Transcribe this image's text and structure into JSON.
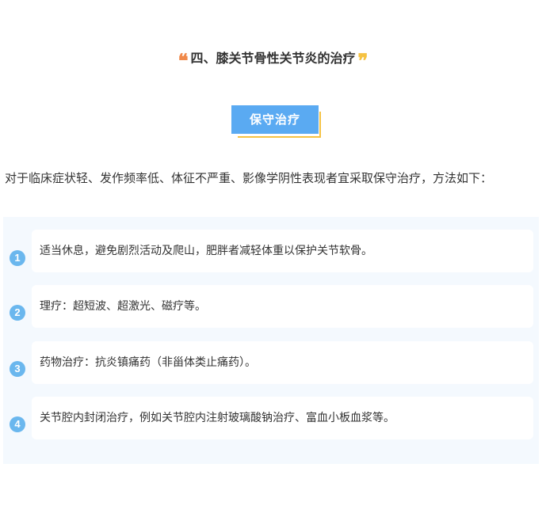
{
  "section": {
    "quote_open": "❝",
    "title": "四、膝关节骨性关节炎的治疗",
    "quote_close": "❞"
  },
  "tag": {
    "label": "保守治疗"
  },
  "intro": "对于临床症状轻、发作频率低、体征不严重、影像学阴性表现者宜采取保守治疗，方法如下：",
  "items": [
    {
      "number": "1",
      "text": "适当休息，避免剧烈活动及爬山，肥胖者减轻体重以保护关节软骨。"
    },
    {
      "number": "2",
      "text": "理疗：超短波、超激光、磁疗等。"
    },
    {
      "number": "3",
      "text": "药物治疗：抗炎镇痛药（非甾体类止痛药）。"
    },
    {
      "number": "4",
      "text": "关节腔内封闭治疗，例如关节腔内注射玻璃酸钠治疗、富血小板血浆等。"
    }
  ],
  "colors": {
    "accent_blue": "#5aaaf2",
    "badge_blue": "#6ab7ee",
    "quote_orange": "#f0894a",
    "quote_yellow": "#f5c242",
    "panel_bg": "#f4f9fe"
  }
}
